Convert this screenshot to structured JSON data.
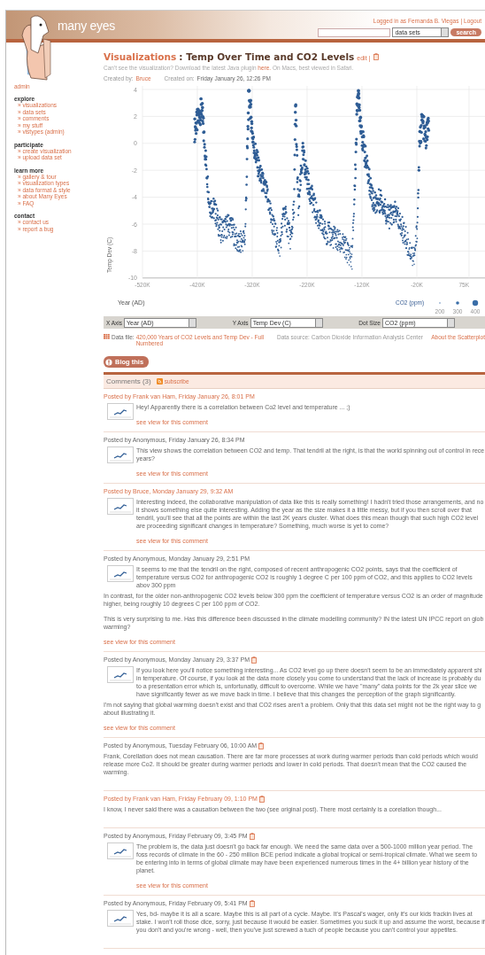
{
  "header": {
    "logo_text": "many eyes",
    "login": {
      "label": "Logged in as",
      "user": "Fernanda B. Viegas",
      "separator": "|",
      "logout": "Logout"
    },
    "search_scope": "data sets",
    "search_button": "search"
  },
  "sidebar": {
    "role": "admin",
    "sections": [
      {
        "title": "explore",
        "items": [
          "» visualizations",
          "» data sets",
          "» comments",
          "» my stuff",
          "» vistypes (admin)"
        ]
      },
      {
        "title": "participate",
        "items": [
          "» create visualization",
          "» upload data set"
        ]
      },
      {
        "title": "learn more",
        "items": [
          "» gallery & tour",
          "» visualization types",
          "» data format & style",
          "» about Many Eyes",
          "» FAQ"
        ]
      },
      {
        "title": "contact",
        "items": [
          "» contact us",
          "» report a bug"
        ]
      }
    ]
  },
  "title": {
    "section": "Visualizations",
    "name": ": Temp Over Time and CO2 Levels",
    "edit": "edit |"
  },
  "notice": {
    "before": "Can't see the visualization? Download the latest Java plugin",
    "link": "here.",
    "after": "On Macs, best viewed in Safari."
  },
  "meta": {
    "created_by_label": "Created by:",
    "author": "Bruce",
    "created_on_label": "Created on:",
    "date": "Friday January 26, 12:26 PM"
  },
  "plot": {
    "y_ticks": [
      "4",
      "2",
      "0",
      "-2",
      "-4",
      "-6",
      "-8",
      "-10"
    ],
    "x_ticks": [
      "-520K",
      "-420K",
      "-320K",
      "-220K",
      "-120K",
      "-20K",
      "75K"
    ],
    "y_label": "Temp Dev (C)",
    "x_label": "Year (AD)",
    "legend_title": "CO2 (ppm)",
    "legend_sizes": [
      "200",
      "300",
      "400"
    ]
  },
  "axis_controls": [
    {
      "label": "X Axis",
      "value": "Year (AD)"
    },
    {
      "label": "Y Axis",
      "value": "Temp Dev (C)"
    },
    {
      "label": "Dot Size",
      "value": "CO2 (ppm)"
    }
  ],
  "data_file": {
    "label": "Data file:",
    "name": "420,000 Years of CO2 Levels and Temp Dev - Full Numbered",
    "source_label": "Data source:",
    "source": "Carbon Dioxide Information Analysis Center",
    "about": "About the Scatterplot"
  },
  "blog_button": "Blog this",
  "comments_header": {
    "title": "Comments (3)",
    "subscribe": "subscribe"
  },
  "comments": [
    {
      "posted_by": "Posted by",
      "author": "Frank van Ham",
      "registered": true,
      "date": ", Friday January 26, 8:01 PM",
      "deletable": false,
      "thumbnail": true,
      "paragraphs": [
        "Hey! Apparently there is a correlation between Co2 level and temperature ... ;)"
      ],
      "view_link": "see view for this comment"
    },
    {
      "posted_by": "Posted by",
      "author": "Anonymous",
      "registered": false,
      "date": ", Friday January 26, 8:34 PM",
      "deletable": false,
      "thumbnail": true,
      "paragraphs": [
        "This view shows the correlation between CO2 and temp. That tendril at the right, is that the world spinning out of control in rece years?"
      ],
      "view_link": "see view for this comment"
    },
    {
      "posted_by": "Posted by",
      "author": "Bruce",
      "registered": true,
      "date": ", Monday January 29, 9:32 AM",
      "deletable": false,
      "thumbnail": true,
      "paragraphs": [
        "Interesting indeed, the collaborative manipulation of data like this is really something! I hadn't tried those arrangements, and no it shows something else quite interesting. Adding the year as the size makes it a little messy, but if you then scroll over that tendril, you'll see that all the points are within the last 2K years cluster. What does this mean though that such high CO2 level are proceeding significant changes in temperature? Something, much worse is yet to come?"
      ],
      "view_link": "see view for this comment"
    },
    {
      "posted_by": "Posted by",
      "author": "Anonymous",
      "registered": false,
      "date": ", Monday January 29, 2:51 PM",
      "deletable": false,
      "thumbnail": true,
      "paragraphs": [
        "It seems to me that the tendril on the right, composed of recent anthropogenic CO2 points, says that the coefficient of temperature versus CO2 for anthropogenic CO2 is roughly 1 degree C per 100 ppm of CO2, and this applies to CO2 levels abov 300 ppm",
        "In contrast, for the older non-anthropogenic CO2 levels below 300 ppm the coefficient of temperature versus CO2 is an order of magnitude higher, being roughly 10 degrees C per 100 ppm of CO2.",
        "This is very surprising to me. Has this difference been discussed in the climate modelling community? IN the latest UN IPCC report on glob warming?"
      ],
      "view_link": "see view for this comment"
    },
    {
      "posted_by": "Posted by",
      "author": "Anonymous",
      "registered": false,
      "date": ", Monday January 29, 3:37 PM",
      "deletable": true,
      "thumbnail": true,
      "paragraphs": [
        "If you look here you'll notice something interesting... As CO2 level go up there doesn't seem to be an immediately apparent shi in temperature. Of course, if you look at the data more closely you come to understand that the lack of increase is probably du to a presentation error which is, unfortunatly, difficult to overcome. While we have \"many\" data points for the 2k year slice we have significantly fewer as we move back in time. I believe that this changes the perception of the graph significantly.",
        "I'm not saying that global warming doesn't exist and that CO2 rises aren't a problem. Only that this data set might not be the right way to g about illustrating it."
      ],
      "view_link": "see view for this comment"
    },
    {
      "posted_by": "Posted by",
      "author": "Anonymous",
      "registered": false,
      "date": ", Tuesday February 06, 10:00 AM",
      "deletable": true,
      "thumbnail": false,
      "paragraphs": [
        "Frank, Corellation does not mean causation. There are far more processes at work during warmer periods than cold periods which would release more Co2. It should be greater during warmer periods and lower in cold periods. That doesn't mean that the CO2 caused the warming."
      ]
    },
    {
      "posted_by": "Posted by",
      "author": "Frank van Ham",
      "registered": true,
      "date": ", Friday February 09, 1:10 PM",
      "deletable": true,
      "thumbnail": false,
      "paragraphs": [
        "I know, I never said there was a causation between the two (see original post). There most certainly is a corelation though..."
      ]
    },
    {
      "posted_by": "Posted by",
      "author": "Anonymous",
      "registered": false,
      "date": ", Friday February 09, 3:45 PM",
      "deletable": true,
      "thumbnail": true,
      "paragraphs": [
        "The problem is, the data just doesn't go back far enough. We need the same data over a 500-1000 million year period. The foss records of climate in the 60 - 250 million BCE period indicate a global tropical or semi-tropical climate. What we seem to be entering into in terms of global climate may have been experienced numerous times in the 4+ billion year history of the planet."
      ],
      "view_link": "see view for this comment"
    },
    {
      "posted_by": "Posted by",
      "author": "Anonymous",
      "registered": false,
      "date": ", Friday February 09, 5:41 PM",
      "deletable": true,
      "thumbnail": true,
      "paragraphs": [
        "Yes, bd- maybe it is all a scare. Maybe this is all part of a cycle. Maybe. It's Pascal's wager, only it's our kids frackin lives at stake. I won't roll those dice, sorry, just because it would be easier. Sometimes you suck it up and assume the worst, because if you don't and you're wrong - well, then you've just screwed a tuch of people because you can't control your appetites."
      ]
    }
  ]
}
